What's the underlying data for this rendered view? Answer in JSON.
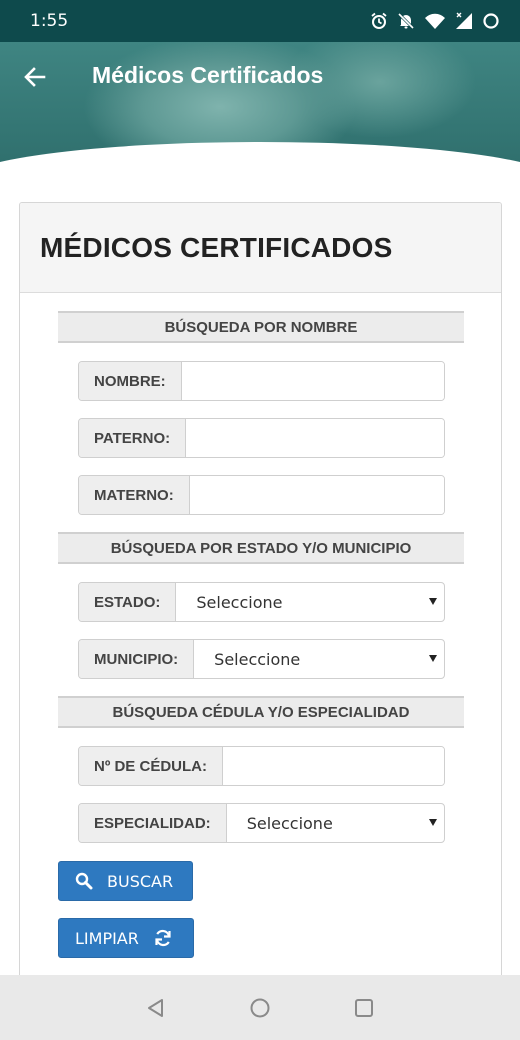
{
  "status_bar": {
    "time": "1:55"
  },
  "header": {
    "title": "Médicos Certificados"
  },
  "card": {
    "title": "MÉDICOS CERTIFICADOS",
    "section_name": {
      "title": "BÚSQUEDA POR NOMBRE"
    },
    "fields_name": [
      {
        "label": "NOMBRE:",
        "value": ""
      },
      {
        "label": "PATERNO:",
        "value": ""
      },
      {
        "label": "MATERNO:",
        "value": ""
      }
    ],
    "section_location": {
      "title": "BÚSQUEDA POR ESTADO Y/O MUNICIPIO"
    },
    "estado": {
      "label": "ESTADO:",
      "selected": "Seleccione"
    },
    "municipio": {
      "label": "MUNICIPIO:",
      "selected": "Seleccione"
    },
    "section_cedula": {
      "title": "BÚSQUEDA CÉDULA Y/O ESPECIALIDAD"
    },
    "cedula": {
      "label": "Nº DE CÉDULA:",
      "value": ""
    },
    "especialidad": {
      "label": "ESPECIALIDAD:",
      "selected": "Seleccione"
    },
    "buttons": {
      "search_label": "BUSCAR",
      "clear_label": "LIMPIAR"
    }
  },
  "icons": {
    "back": "arrow-left-icon",
    "search": "search-icon",
    "refresh": "refresh-icon",
    "nav": [
      "back-triangle-icon",
      "home-circle-icon",
      "recents-square-icon"
    ]
  },
  "colors": {
    "status_bar": "#0e4a4c",
    "header": "#3f8582",
    "button": "#2e79c0"
  }
}
